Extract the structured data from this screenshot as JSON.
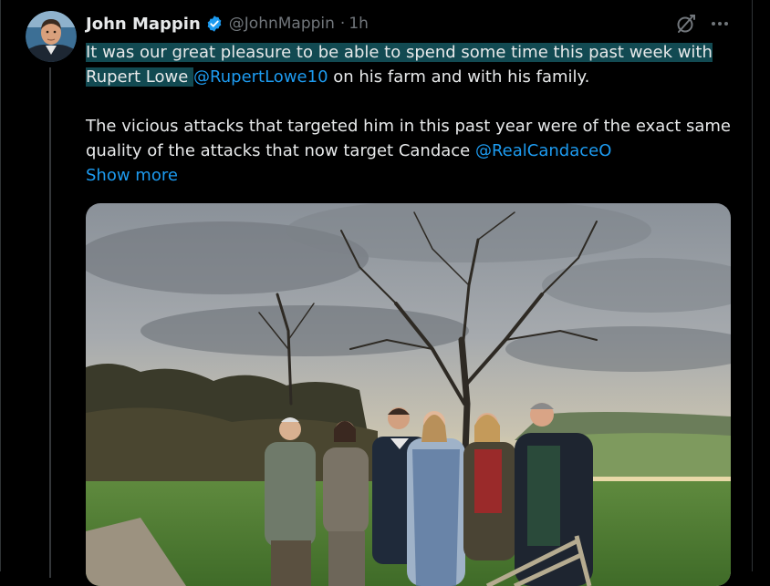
{
  "author": {
    "name": "John Mappin",
    "handle": "@JohnMappin",
    "time": "1h"
  },
  "tweet": {
    "line1_highlighted": "It was our great pleasure to be able to spend some time this past week with",
    "line2_highlighted": "Rupert Lowe ",
    "mention1": "@RupertLowe10",
    "line2_rest": " on his farm and with his family.",
    "para2_text": "The vicious attacks that targeted him in this past year were of the exact same quality of the attacks that now target Candace ",
    "mention2": "@RealCandaceO",
    "show_more": "Show more"
  },
  "icons": {
    "verified": "verified-badge-icon",
    "grok": "grok-icon",
    "more": "more-options-icon"
  },
  "colors": {
    "background": "#000000",
    "text": "#e7e9ea",
    "secondary": "#71767b",
    "link": "#1d9bf0",
    "highlight": "#124a52"
  }
}
